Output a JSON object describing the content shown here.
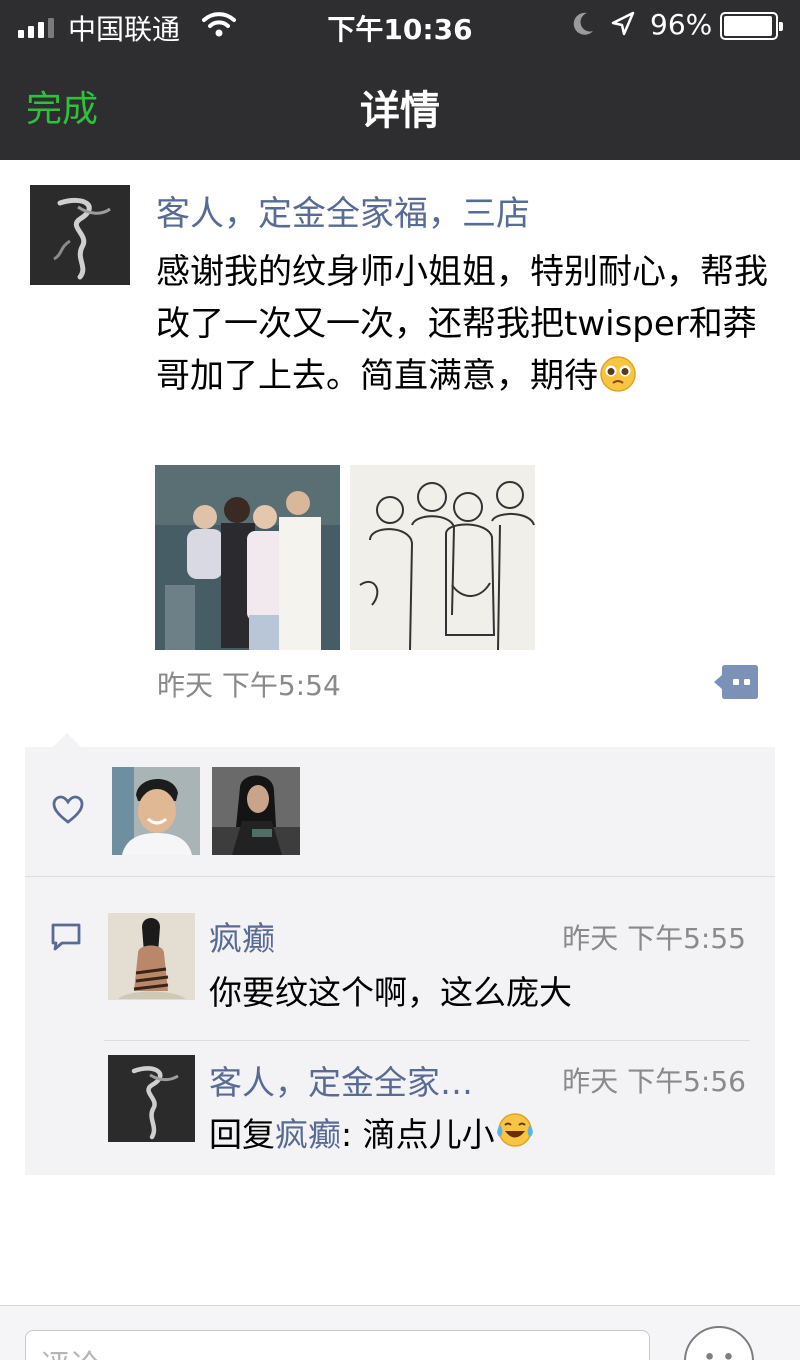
{
  "status_bar": {
    "carrier": "中国联通",
    "time": "下午10:36",
    "battery_text": "96%",
    "battery_level": 0.96
  },
  "nav": {
    "done_label": "完成",
    "title": "详情"
  },
  "post": {
    "author": "客人，定金全家福，三店",
    "text": "感谢我的纹身师小姐姐，特别耐心，帮我改了一次又一次，还帮我把twisper和莽哥加了上去。简直满意，期待",
    "time": "昨天 下午5:54"
  },
  "comments": [
    {
      "name": "疯癫",
      "time": "昨天 下午5:55",
      "text": "你要纹这个啊，这么庞大"
    },
    {
      "name": "客人，定金全家…",
      "time": "昨天 下午5:56",
      "reply_prefix": "回复",
      "reply_to": "疯癫",
      "reply_text": ": 滴点儿小"
    }
  ],
  "comment_bar": {
    "placeholder": "评论"
  },
  "colors": {
    "nav_bg": "#2e2e31",
    "done_green": "#2ec23a",
    "name_blue": "#576b95",
    "panel_bg": "#f3f3f5",
    "meta_gray": "#8a8a8a"
  }
}
